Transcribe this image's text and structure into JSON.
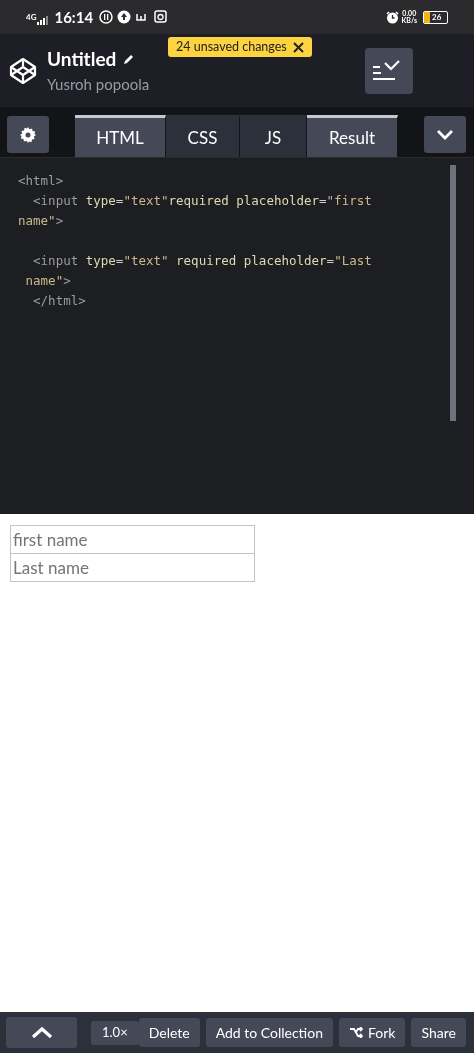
{
  "status_bar": {
    "network": "4G",
    "time": "16:14",
    "speed": "0.00",
    "speed_unit": "KB/s",
    "battery": "26"
  },
  "header": {
    "title": "Untitled",
    "author": "Yusroh popoola",
    "unsaved_badge": "24 unsaved changes"
  },
  "tabs": [
    {
      "label": "HTML",
      "selected": true
    },
    {
      "label": "CSS",
      "selected": false
    },
    {
      "label": "JS",
      "selected": false
    },
    {
      "label": "Result",
      "selected": true
    }
  ],
  "code_lines": [
    [
      {
        "kind": "tag",
        "text": "<html>"
      }
    ],
    [
      {
        "kind": "tag",
        "text": "  <input"
      },
      {
        "kind": "attr",
        "text": " type"
      },
      {
        "kind": "punct",
        "text": "="
      },
      {
        "kind": "string",
        "text": "\"text\""
      },
      {
        "kind": "attr",
        "text": "required placeholder"
      },
      {
        "kind": "punct",
        "text": "="
      },
      {
        "kind": "string",
        "text": "\"first"
      }
    ],
    [
      {
        "kind": "string",
        "text": "name\""
      },
      {
        "kind": "tag",
        "text": ">"
      }
    ],
    {
      "kind": "blank"
    },
    [
      {
        "kind": "tag",
        "text": "  <input"
      },
      {
        "kind": "attr",
        "text": " type"
      },
      {
        "kind": "punct",
        "text": "="
      },
      {
        "kind": "string",
        "text": "\"text\""
      },
      {
        "kind": "attr",
        "text": " required placeholder"
      },
      {
        "kind": "punct",
        "text": "="
      },
      {
        "kind": "string",
        "text": "\"Last"
      }
    ],
    [
      {
        "kind": "string",
        "text": " name\""
      },
      {
        "kind": "tag",
        "text": ">"
      }
    ],
    [
      {
        "kind": "tag",
        "text": "  </html>"
      }
    ]
  ],
  "result_inputs": [
    {
      "placeholder": "first name"
    },
    {
      "placeholder": "Last name"
    }
  ],
  "bottom_bar": {
    "zoom": "1.0×",
    "buttons": [
      {
        "kind": "plain",
        "label": "Delete"
      },
      {
        "kind": "plain",
        "label": "Add to Collection"
      },
      {
        "kind": "fork",
        "label": "Fork"
      },
      {
        "kind": "plain",
        "label": "Share"
      }
    ]
  }
}
